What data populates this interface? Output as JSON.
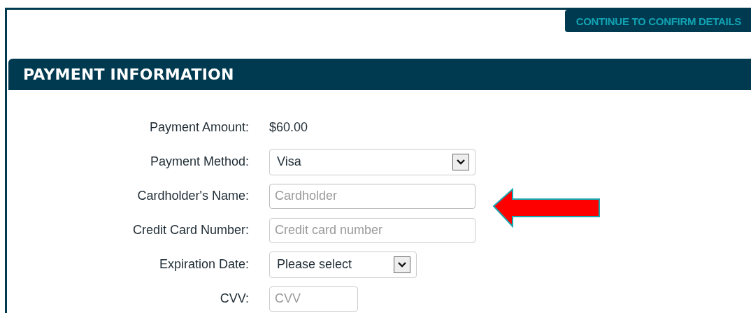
{
  "continue_button": {
    "label": "CONTINUE TO CONFIRM DETAILS"
  },
  "section": {
    "title": "PAYMENT INFORMATION"
  },
  "fields": [
    {
      "kind": "text",
      "label": "Payment Amount:",
      "value": "$60.00"
    },
    {
      "kind": "select",
      "label": "Payment Method:",
      "value": "Visa"
    },
    {
      "kind": "input",
      "label": "Cardholder's Name:",
      "placeholder": "Cardholder",
      "highlighted": true
    },
    {
      "kind": "input",
      "label": "Credit Card Number:",
      "placeholder": "Credit card number",
      "highlighted": false
    },
    {
      "kind": "select",
      "label": "Expiration Date:",
      "value": "Please select"
    },
    {
      "kind": "input",
      "label": "CVV:",
      "placeholder": "CVV",
      "highlighted": false
    }
  ]
}
